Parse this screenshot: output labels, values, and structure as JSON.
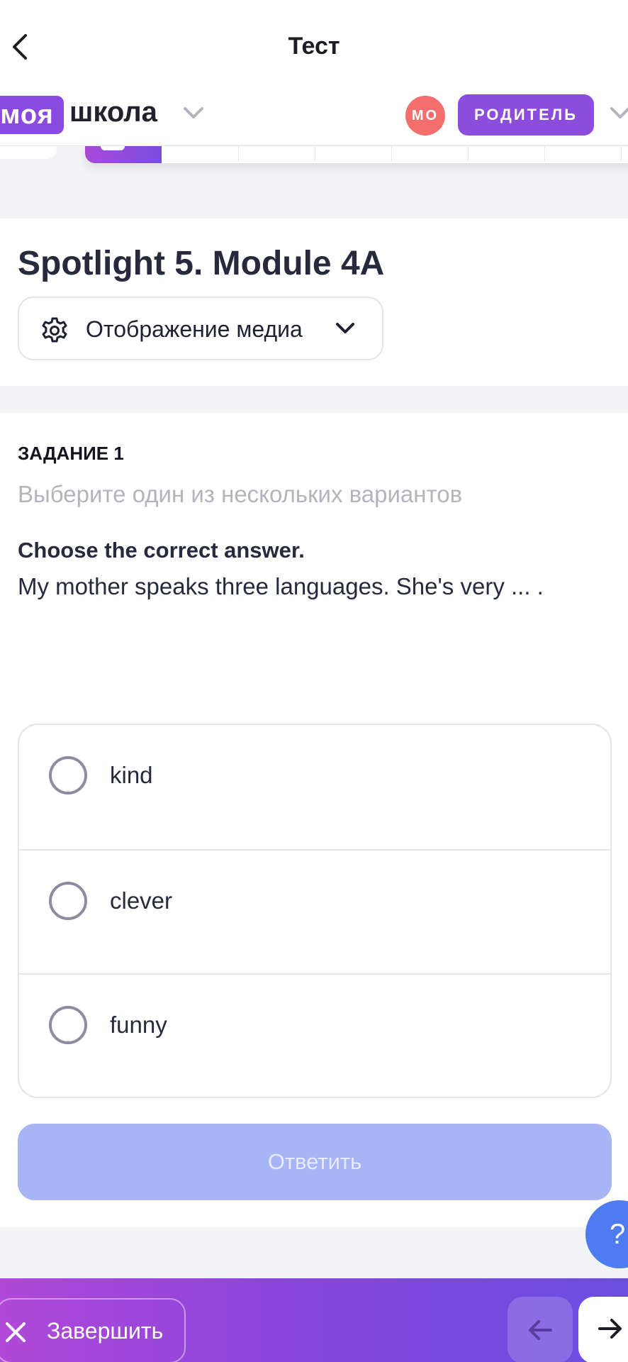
{
  "header": {
    "title": "Тест"
  },
  "school": {
    "logo_box": "моя",
    "logo_text": "школа",
    "avatar_initials": "МО",
    "role_label": "РОДИТЕЛЬ"
  },
  "test": {
    "title": "Spotlight 5. Module 4A",
    "media_label": "Отображение медиа"
  },
  "task": {
    "label": "ЗАДАНИЕ 1",
    "hint": "Выберите один из нескольких вариантов",
    "question_title": "Choose the correct answer.",
    "question_text": "My mother speaks three languages. She's very ... .",
    "options": [
      {
        "label": "kind"
      },
      {
        "label": "clever"
      },
      {
        "label": "funny"
      }
    ],
    "submit_label": "Ответить"
  },
  "help": {
    "label": "?"
  },
  "footer": {
    "finish_label": "Завершить"
  },
  "colors": {
    "brand": "#8a4ae0",
    "avatar": "#f56e6e",
    "submit_disabled": "#a7b4f6",
    "help": "#4f7bf0"
  }
}
